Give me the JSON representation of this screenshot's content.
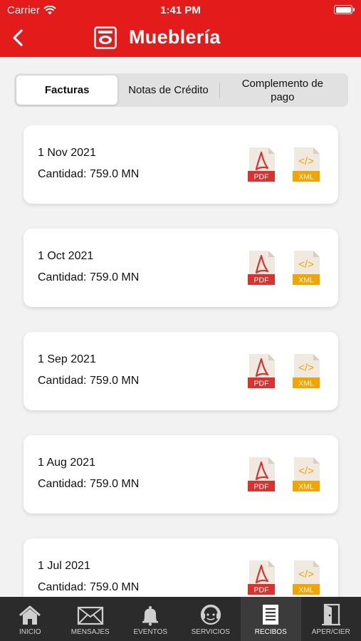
{
  "status": {
    "carrier": "Carrier",
    "time": "1:41 PM"
  },
  "header": {
    "title": "Mueblería"
  },
  "tabs": [
    {
      "label": "Facturas",
      "active": true
    },
    {
      "label": "Notas de Crédito",
      "active": false
    },
    {
      "label": "Complemento de pago",
      "active": false
    }
  ],
  "documents": [
    {
      "date": "1 Nov 2021",
      "amount": "Cantidad:  759.0 MN"
    },
    {
      "date": "1 Oct 2021",
      "amount": "Cantidad:  759.0 MN"
    },
    {
      "date": "1 Sep 2021",
      "amount": "Cantidad:  759.0 MN"
    },
    {
      "date": "1 Aug 2021",
      "amount": "Cantidad:  759.0 MN"
    },
    {
      "date": "1 Jul 2021",
      "amount": "Cantidad:  759.0 MN"
    }
  ],
  "icons": {
    "pdf_label": "PDF",
    "xml_label": "XML",
    "xml_symbol": "</>"
  },
  "bottom_nav": [
    {
      "label": "INICIO",
      "icon": "home-icon"
    },
    {
      "label": "MENSAJES",
      "icon": "envelope-icon"
    },
    {
      "label": "EVENTOS",
      "icon": "bell-icon"
    },
    {
      "label": "SERVICIOS",
      "icon": "support-agent-icon"
    },
    {
      "label": "RECIBOS",
      "icon": "receipt-icon",
      "active": true
    },
    {
      "label": "APER/CIER",
      "icon": "door-icon"
    }
  ],
  "colors": {
    "brand": "#e31b1b",
    "pdf": "#d9322f",
    "xml": "#f2a400",
    "tabbar": "#2b2b2b"
  }
}
